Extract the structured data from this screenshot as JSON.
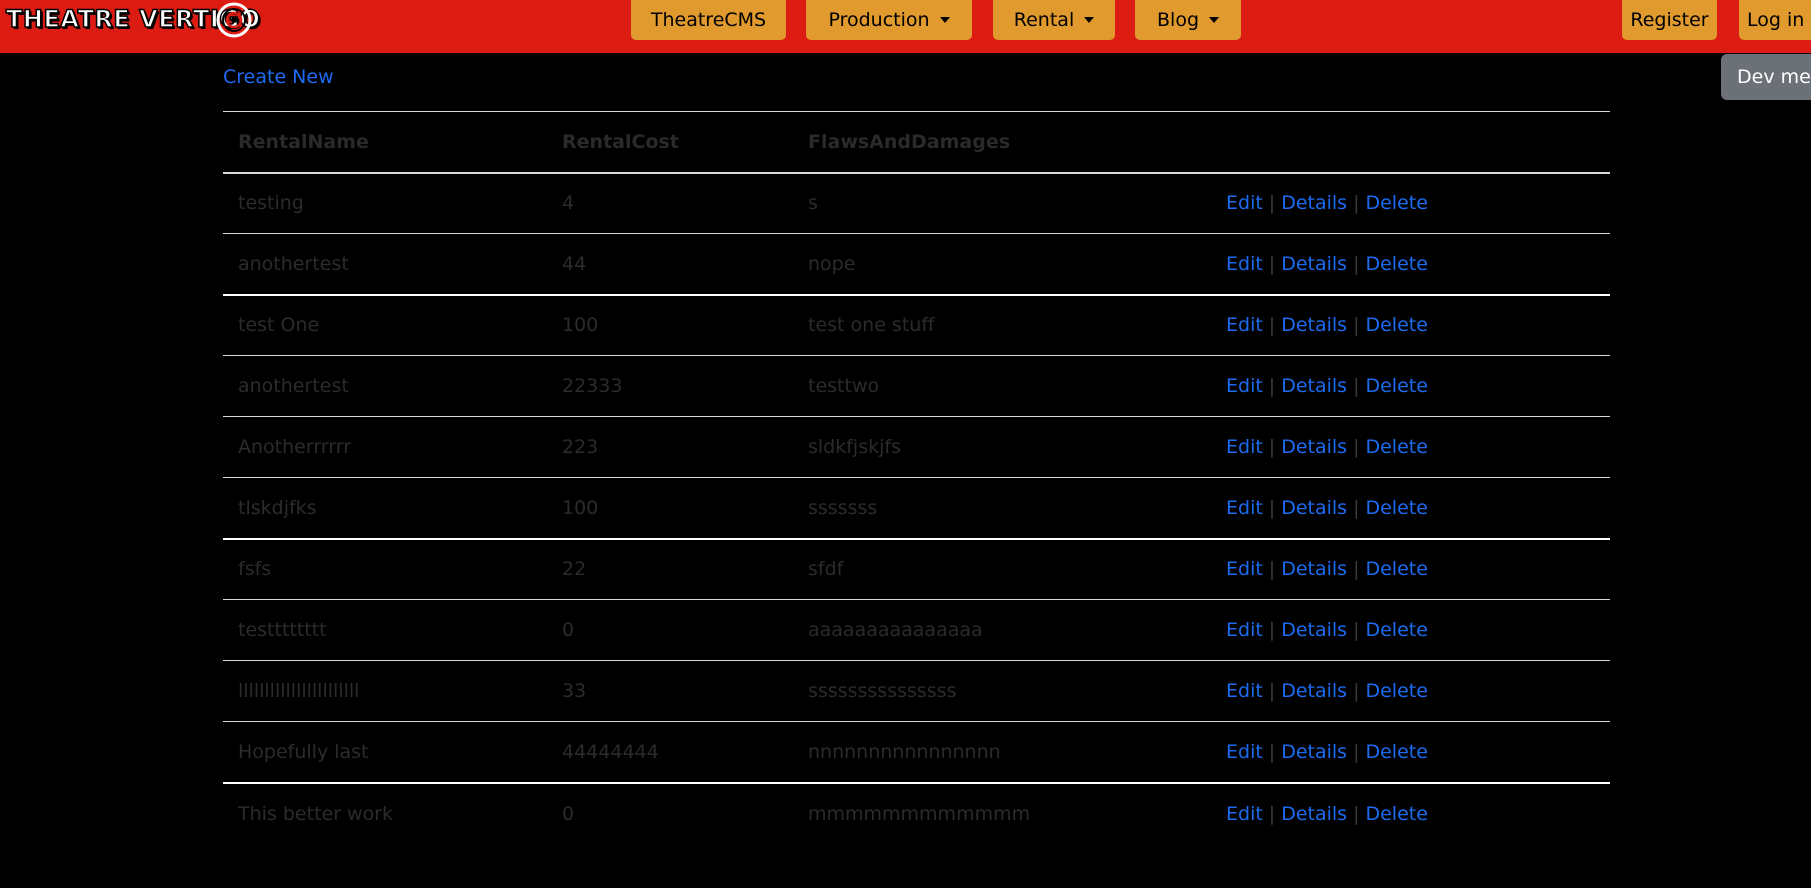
{
  "brand": {
    "logo_text": "THEATRE VERTIGO"
  },
  "nav": {
    "theatrecms": "TheatreCMS",
    "production": "Production",
    "rental": "Rental",
    "blog": "Blog",
    "register": "Register",
    "login": "Log in"
  },
  "dev_menu": {
    "label": "Dev menu"
  },
  "page": {
    "create_new": "Create New"
  },
  "table": {
    "headers": [
      "RentalName",
      "RentalCost",
      "FlawsAndDamages"
    ],
    "actions": {
      "edit": "Edit",
      "details": "Details",
      "delete": "Delete",
      "separator": "|"
    },
    "rows": [
      {
        "name": "testing",
        "cost": "4",
        "flaws": "s"
      },
      {
        "name": "anothertest",
        "cost": "44",
        "flaws": "nope"
      },
      {
        "name": "test One",
        "cost": "100",
        "flaws": "test one stuff"
      },
      {
        "name": "anothertest",
        "cost": "22333",
        "flaws": "testtwo"
      },
      {
        "name": "Anotherrrrrr",
        "cost": "223",
        "flaws": "sldkfjskjfs"
      },
      {
        "name": "tlskdjfks",
        "cost": "100",
        "flaws": "sssssss"
      },
      {
        "name": "fsfs",
        "cost": "22",
        "flaws": "sfdf"
      },
      {
        "name": "testttttttt",
        "cost": "0",
        "flaws": "aaaaaaaaaaaaaaa"
      },
      {
        "name": "lllllllllllllllllllllll",
        "cost": "33",
        "flaws": "sssssssssssssss"
      },
      {
        "name": "Hopefully last",
        "cost": "44444444",
        "flaws": "nnnnnnnnnnnnnnnn"
      },
      {
        "name": "This better work",
        "cost": "0",
        "flaws": "mmmmmmmmmmmm"
      }
    ]
  },
  "colors": {
    "nav_bar": "#dc1c13",
    "nav_button": "#e09a2d",
    "link": "#1c6bf0",
    "dev_menu": "#6b7177",
    "background": "#000000"
  }
}
